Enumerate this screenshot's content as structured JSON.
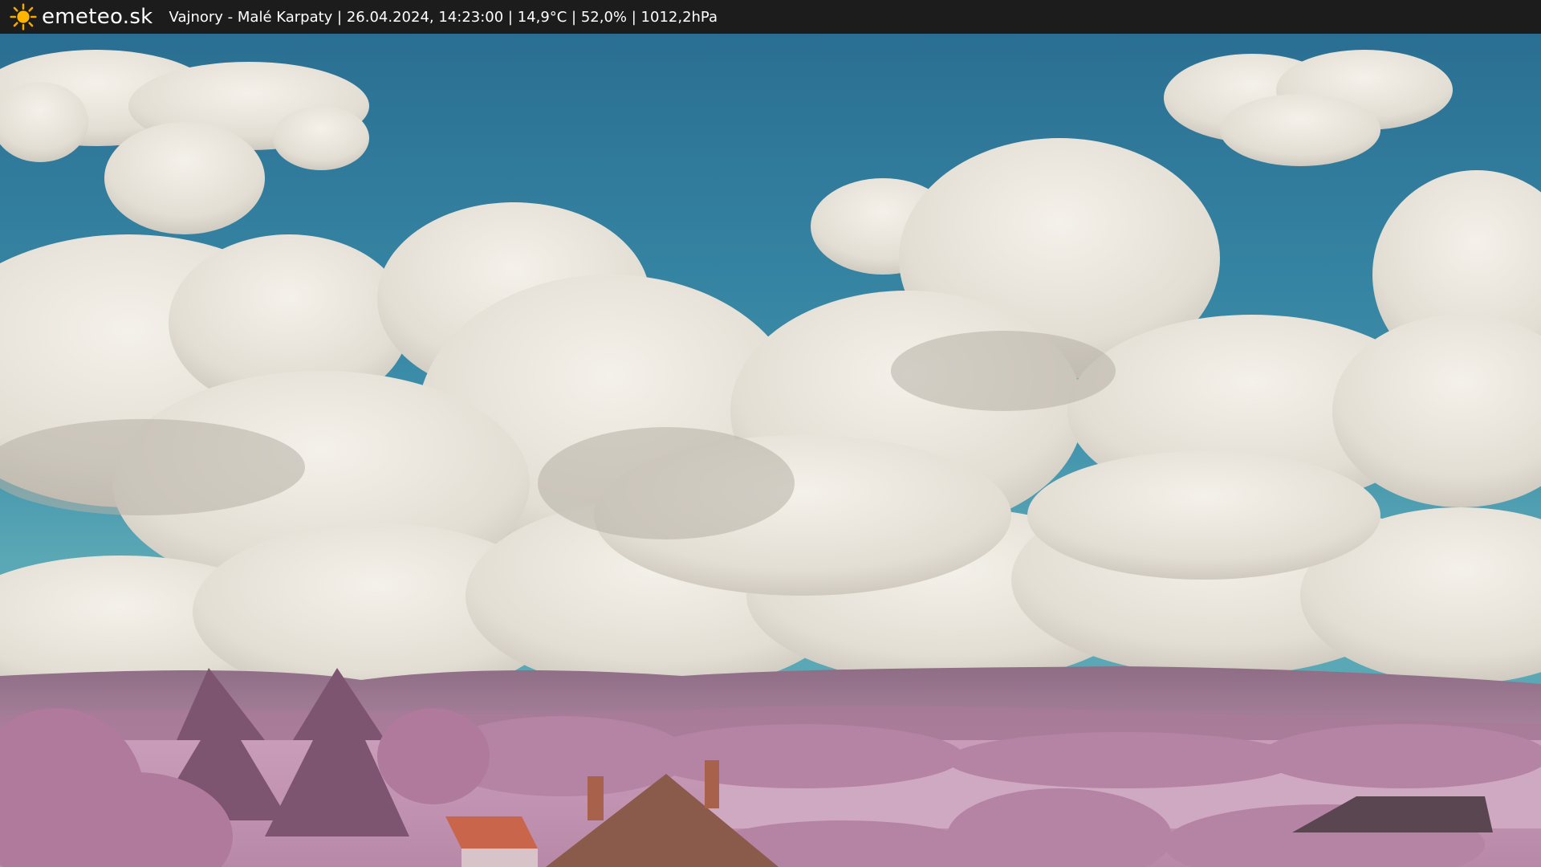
{
  "header": {
    "brand": "emeteo.sk",
    "caption": "Vajnory - Malé Karpaty | 26.04.2024, 14:23:00 | 14,9°C | 52,0% | 1012,2hPa"
  },
  "icons": {
    "logo": "sun-icon"
  },
  "colors": {
    "header_bg": "#1c1c1c",
    "sky": "#2f7fa0",
    "cloud": "#ece8e2",
    "foliage": "#c28fb0",
    "roof": "#c9654a"
  }
}
